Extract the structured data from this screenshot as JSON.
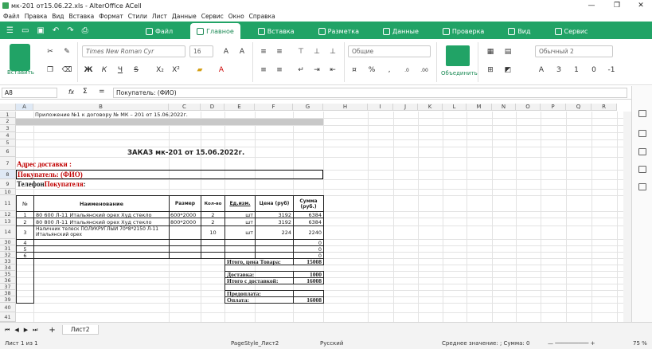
{
  "window": {
    "title": "мк-201 от15.06.22.xls - AlterOffice ACell"
  },
  "menu": [
    "Файл",
    "Правка",
    "Вид",
    "Вставка",
    "Формат",
    "Стили",
    "Лист",
    "Данные",
    "Сервис",
    "Окно",
    "Справка"
  ],
  "tabs": [
    {
      "label": "Файл"
    },
    {
      "label": "Главное"
    },
    {
      "label": "Вставка"
    },
    {
      "label": "Разметка"
    },
    {
      "label": "Данные"
    },
    {
      "label": "Проверка"
    },
    {
      "label": "Вид"
    },
    {
      "label": "Сервис"
    }
  ],
  "ribbon": {
    "paste_label": "Вставить",
    "font_name": "Times New Roman Cyr",
    "font_size": "16",
    "number_format": "Общие",
    "merge_label": "Объединить",
    "style_name": "Обычный 2"
  },
  "formula": {
    "cell_ref": "A8",
    "content": "Покупатель: (ФИО)",
    "fx": "fx",
    "sigma": "Σ",
    "eq": "="
  },
  "columns": [
    "A",
    "B",
    "C",
    "D",
    "E",
    "F",
    "G",
    "H",
    "I",
    "J",
    "K",
    "L",
    "M",
    "N",
    "O",
    "P",
    "Q",
    "R"
  ],
  "rows": [
    "1",
    "2",
    "3",
    "4",
    "5",
    "6",
    "7",
    "8",
    "9",
    "10",
    "11",
    "12",
    "13",
    "14",
    "30",
    "31",
    "32",
    "33",
    "34",
    "35",
    "36",
    "37",
    "38",
    "39",
    "40",
    "41"
  ],
  "sheet": {
    "appendix": "Приложение №1  к договору № МК – 201 от  15.06.2022г.",
    "order_title": "ЗАКАЗ мк-201  от 15.06.2022г.",
    "addr_label": "Адрес доставки :",
    "buyer_label": "Покупатель: (ФИО)",
    "phone_label_a": "Телефон ",
    "phone_label_b": "Покупателя",
    "phone_label_c": ":",
    "headers": {
      "num": "№",
      "name": "Наименование",
      "size": "Размер",
      "qty": "Кол-во",
      "unit": "Ед.изм.",
      "price": "Цена (руб)",
      "sum": "Сумма (руб.)"
    },
    "items": [
      {
        "num": "1",
        "name": "80 600 Л-11 Итальянский орех Худ стекло",
        "size": "600*2000",
        "qty": "2",
        "unit": "шт",
        "price": "3192",
        "sum": "6384"
      },
      {
        "num": "2",
        "name": "80 800 Л-11 Итальянский орех Худ стекло",
        "size": "800*2000",
        "qty": "2",
        "unit": "шт",
        "price": "3192",
        "sum": "6384"
      },
      {
        "num": "3",
        "name": "Наличник телеск ПОЛУКРУГЛЫЙ 70*8*2150 Л-11 Итальянский орех",
        "size": "",
        "qty": "10",
        "unit": "шт",
        "price": "224",
        "sum": "2240"
      },
      {
        "num": "4",
        "name": "",
        "size": "",
        "qty": "",
        "unit": "",
        "price": "",
        "sum": "0"
      },
      {
        "num": "5",
        "name": "",
        "size": "",
        "qty": "",
        "unit": "",
        "price": "",
        "sum": "0"
      },
      {
        "num": "6",
        "name": "",
        "size": "",
        "qty": "",
        "unit": "",
        "price": "",
        "sum": "0"
      }
    ],
    "totals": [
      {
        "label": "Итого, цена Товара:",
        "value": "15008"
      },
      {
        "label": "Доставка:",
        "value": "1000"
      },
      {
        "label": "Итого с доставкой:",
        "value": "16008"
      },
      {
        "label": "Предоплата:",
        "value": ""
      },
      {
        "label": "Оплата:",
        "value": "16008"
      }
    ]
  },
  "sheettab": "Лист2",
  "status": {
    "sheet": "Лист 1 из 1",
    "page_style": "PageStyle_Лист2",
    "lang": "Русский",
    "summary": "Среднее значение: ; Сумма: 0",
    "zoom": "75 %"
  }
}
